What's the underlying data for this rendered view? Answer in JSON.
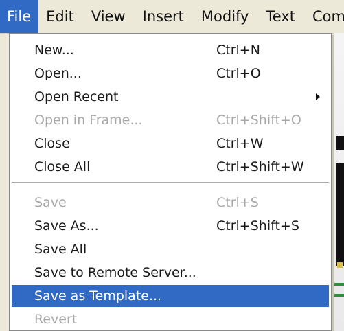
{
  "menubar": {
    "items": [
      {
        "label": "File"
      },
      {
        "label": "Edit"
      },
      {
        "label": "View"
      },
      {
        "label": "Insert"
      },
      {
        "label": "Modify"
      },
      {
        "label": "Text"
      },
      {
        "label": "Comm"
      }
    ]
  },
  "file_menu": {
    "items": [
      {
        "label": "New...",
        "shortcut": "Ctrl+N"
      },
      {
        "label": "Open...",
        "shortcut": "Ctrl+O"
      },
      {
        "label": "Open Recent",
        "shortcut": ""
      },
      {
        "label": "Open in Frame...",
        "shortcut": "Ctrl+Shift+O"
      },
      {
        "label": "Close",
        "shortcut": "Ctrl+W"
      },
      {
        "label": "Close All",
        "shortcut": "Ctrl+Shift+W"
      },
      {
        "label": "Save",
        "shortcut": "Ctrl+S"
      },
      {
        "label": "Save As...",
        "shortcut": "Ctrl+Shift+S"
      },
      {
        "label": "Save All",
        "shortcut": ""
      },
      {
        "label": "Save to Remote Server...",
        "shortcut": ""
      },
      {
        "label": "Save as Template...",
        "shortcut": ""
      },
      {
        "label": "Revert",
        "shortcut": ""
      }
    ]
  },
  "colors": {
    "highlight": "#316ac5",
    "menubar_bg": "#ece9d8",
    "disabled_text": "#a8a8a8"
  }
}
